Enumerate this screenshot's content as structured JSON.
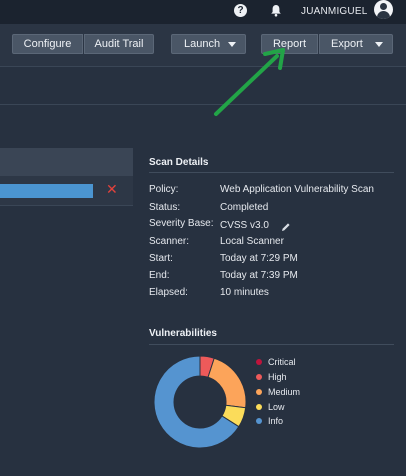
{
  "topbar": {
    "username": "JUANMIGUEL",
    "help_icon": "help-icon",
    "bell_icon": "bell-icon",
    "help_glyph": "?"
  },
  "toolbar": {
    "configure_label": "Configure",
    "audit_trail_label": "Audit Trail",
    "launch_label": "Launch",
    "report_label": "Report",
    "export_label": "Export"
  },
  "scan_progress": {
    "fill_fraction": 1.0,
    "close_glyph": "✕"
  },
  "scan_details": {
    "title": "Scan Details",
    "rows": [
      {
        "label": "Policy:",
        "value": "Web Application Vulnerability Scan"
      },
      {
        "label": "Status:",
        "value": "Completed"
      },
      {
        "label": "Severity Base:",
        "value": "CVSS v3.0"
      },
      {
        "label": "Scanner:",
        "value": "Local Scanner"
      },
      {
        "label": "Start:",
        "value": "Today at 7:29 PM"
      },
      {
        "label": "End:",
        "value": "Today at 7:39 PM"
      },
      {
        "label": "Elapsed:",
        "value": "10 minutes"
      }
    ]
  },
  "vulnerabilities": {
    "title": "Vulnerabilities",
    "legend": [
      {
        "label": "Critical",
        "color": "#c0143c"
      },
      {
        "label": "High",
        "color": "#ee5a5a"
      },
      {
        "label": "Medium",
        "color": "#fca45a"
      },
      {
        "label": "Low",
        "color": "#fbdc5a"
      },
      {
        "label": "Info",
        "color": "#5594d0"
      }
    ]
  },
  "chart_data": {
    "type": "pie",
    "categories": [
      "Critical",
      "High",
      "Medium",
      "Low",
      "Info"
    ],
    "values": [
      0,
      5,
      22,
      7,
      66
    ],
    "colors": [
      "#c0143c",
      "#ee5a5a",
      "#fca45a",
      "#fbdc5a",
      "#5594d0"
    ]
  },
  "colors": {
    "background": "#273140",
    "topbar": "#1b232f",
    "arrow": "#22a447"
  }
}
